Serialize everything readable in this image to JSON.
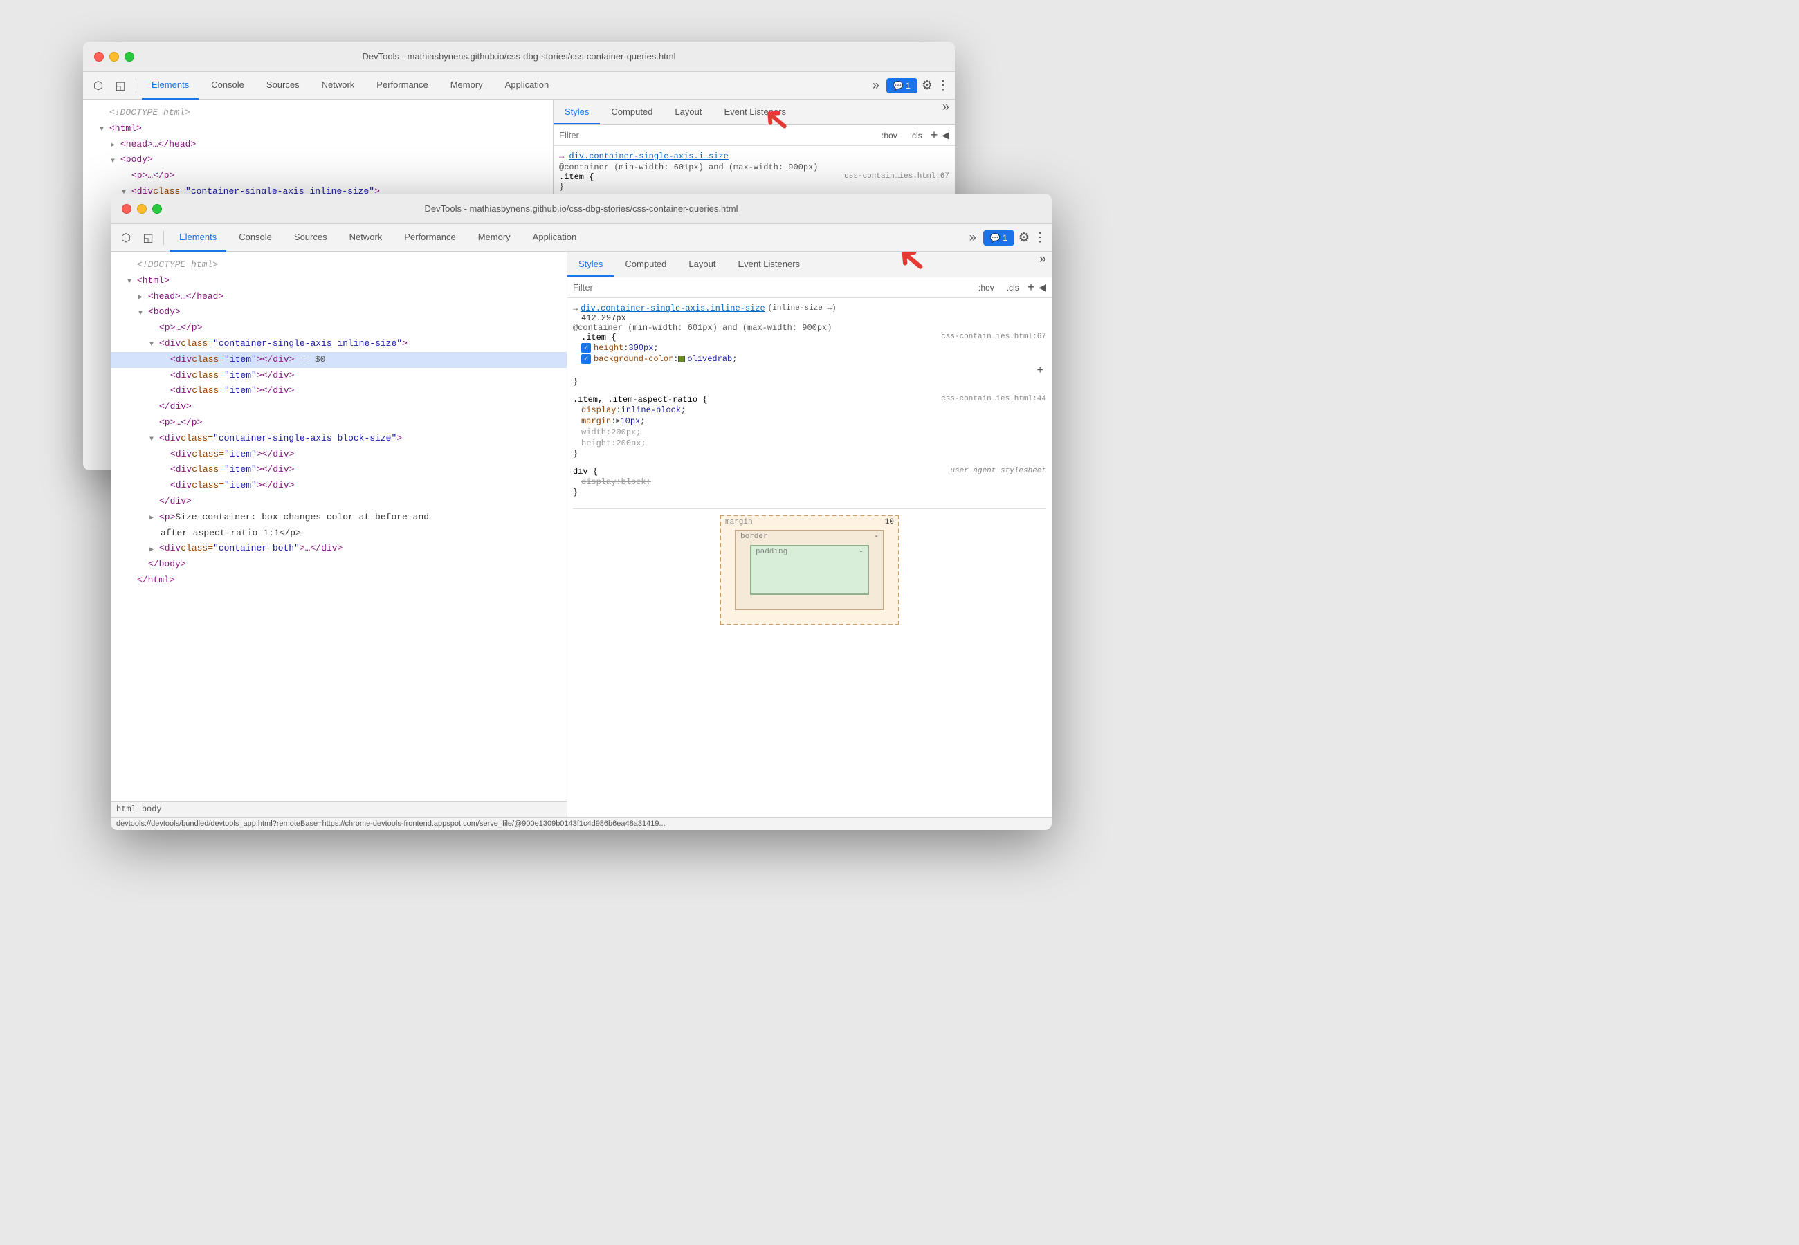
{
  "back_window": {
    "title": "DevTools - mathiasbynens.github.io/css-dbg-stories/css-container-queries.html",
    "tabs": [
      "Elements",
      "Console",
      "Sources",
      "Network",
      "Performance",
      "Memory",
      "Application"
    ],
    "active_tab": "Elements",
    "styles_tabs": [
      "Styles",
      "Computed",
      "Layout",
      "Event Listeners"
    ],
    "active_style_tab": "Styles",
    "filter_placeholder": "Filter",
    "filter_actions": [
      ":hov",
      ".cls",
      "+"
    ],
    "html_lines": [
      {
        "text": "<!DOCTYPE html>",
        "type": "comment",
        "indent": 0
      },
      {
        "text": "<html>",
        "type": "tag",
        "indent": 0,
        "expanded": true
      },
      {
        "text": "<head>…</head>",
        "type": "tag",
        "indent": 1
      },
      {
        "text": "<body>",
        "type": "tag",
        "indent": 1,
        "expanded": true
      },
      {
        "text": "<p>…</p>",
        "type": "tag",
        "indent": 2
      },
      {
        "text": "<div class=\"container-single-axis inline-size\">",
        "type": "tag",
        "indent": 2,
        "expanded": true
      }
    ],
    "css_rules": [
      {
        "selector": "→ div.container-single-axis.i…size",
        "link": true,
        "container_rule": "@container (min-width: 601px) and (max-width: 900px)",
        "rule_selector": ".item {",
        "source": "css-contain…ies.html:67",
        "closing": "}"
      }
    ]
  },
  "front_window": {
    "title": "DevTools - mathiasbynens.github.io/css-dbg-stories/css-container-queries.html",
    "tabs": [
      "Elements",
      "Console",
      "Sources",
      "Network",
      "Performance",
      "Memory",
      "Application"
    ],
    "active_tab": "Elements",
    "styles_tabs": [
      "Styles",
      "Computed",
      "Layout",
      "Event Listeners"
    ],
    "active_style_tab": "Styles",
    "filter_placeholder": "Filter",
    "filter_actions": [
      ":hov",
      ".cls",
      "+"
    ],
    "html_lines": [
      {
        "text": "<!DOCTYPE html>",
        "type": "comment",
        "indent": 0
      },
      {
        "text": "<html>",
        "tag": "html",
        "indent": 0
      },
      {
        "text": "<head>…</head>",
        "tag": "head",
        "indent": 1
      },
      {
        "text": "<body>",
        "tag": "body",
        "indent": 1
      },
      {
        "text": "<p>…</p>",
        "tag": "p",
        "indent": 2
      },
      {
        "text": "<div class=\"container-single-axis inline-size\">",
        "tag": "div",
        "indent": 2,
        "expanded": true
      },
      {
        "text": "<div class=\"item\"></div>",
        "tag": "div",
        "indent": 3,
        "selected": true,
        "suffix": " == $0"
      },
      {
        "text": "<div class=\"item\"></div>",
        "tag": "div",
        "indent": 3
      },
      {
        "text": "<div class=\"item\"></div>",
        "tag": "div",
        "indent": 3
      },
      {
        "text": "</div>",
        "tag": "/div",
        "indent": 2
      },
      {
        "text": "<p>…</p>",
        "tag": "p",
        "indent": 2
      },
      {
        "text": "<div class=\"container-single-axis block-size\">",
        "tag": "div",
        "indent": 2,
        "expanded": true
      },
      {
        "text": "<div class=\"item\"></div>",
        "tag": "div",
        "indent": 3
      },
      {
        "text": "<div class=\"item\"></div>",
        "tag": "div",
        "indent": 3
      },
      {
        "text": "<div class=\"item\"></div>",
        "tag": "div",
        "indent": 3
      },
      {
        "text": "</div>",
        "tag": "/div",
        "indent": 2
      },
      {
        "text": "<p>Size container: box changes color at before and after aspect-ratio 1:1</p>",
        "tag": "p",
        "indent": 2
      },
      {
        "text": "<div class=\"container-both\">…</div>",
        "tag": "div",
        "indent": 2
      },
      {
        "text": "</body>",
        "tag": "/body",
        "indent": 1
      },
      {
        "text": "</html>",
        "tag": "/html",
        "indent": 0
      }
    ],
    "css_rules": [
      {
        "selector_link": "div.container-single-axis.inline-size",
        "selector_suffix": "(inline-size ↔)",
        "px_value": "412.297px",
        "container_rule": "@container (min-width: 601px) and (max-width: 900px)",
        "rule_selector": ".item {",
        "source": "css-contain…ies.html:67",
        "properties": [
          {
            "checked": true,
            "name": "height",
            "value": "300px",
            "strikethrough": false
          },
          {
            "checked": true,
            "name": "background-color",
            "value": "olivedrab",
            "is_color": true,
            "strikethrough": false
          }
        ],
        "closing": "}"
      },
      {
        "selector": ".item, .item-aspect-ratio {",
        "source": "css-contain…ies.html:44",
        "properties": [
          {
            "checked": false,
            "name": "display",
            "value": "inline-block",
            "strikethrough": false
          },
          {
            "checked": false,
            "name": "margin",
            "value": "▶ 10px",
            "strikethrough": false
          },
          {
            "checked": false,
            "name": "width",
            "value": "200px",
            "strikethrough": true
          },
          {
            "checked": false,
            "name": "height",
            "value": "200px",
            "strikethrough": true
          }
        ],
        "closing": "}"
      },
      {
        "selector": "div {",
        "is_user_agent": true,
        "source": "user agent stylesheet",
        "properties": [
          {
            "checked": false,
            "name": "display",
            "value": "block",
            "strikethrough": true
          }
        ],
        "closing": "}"
      }
    ],
    "breadcrumbs": [
      "html",
      "body"
    ],
    "box_model": {
      "margin_label": "margin",
      "margin_value": "10",
      "border_label": "border",
      "border_value": "-",
      "padding_label": "padding",
      "padding_value": "-"
    },
    "status_bar": "devtools://devtools/bundled/devtools_app.html?remoteBase=https://chrome-devtools-frontend.appspot.com/serve_file/@900e1309b0143f1c4d986b6ea48a31419..."
  },
  "icons": {
    "cursor": "⬡",
    "mobile": "◱",
    "more": "»",
    "chat": "💬",
    "settings": "⚙",
    "dots": "⋮",
    "plus": "+",
    "toggle": "◀"
  }
}
